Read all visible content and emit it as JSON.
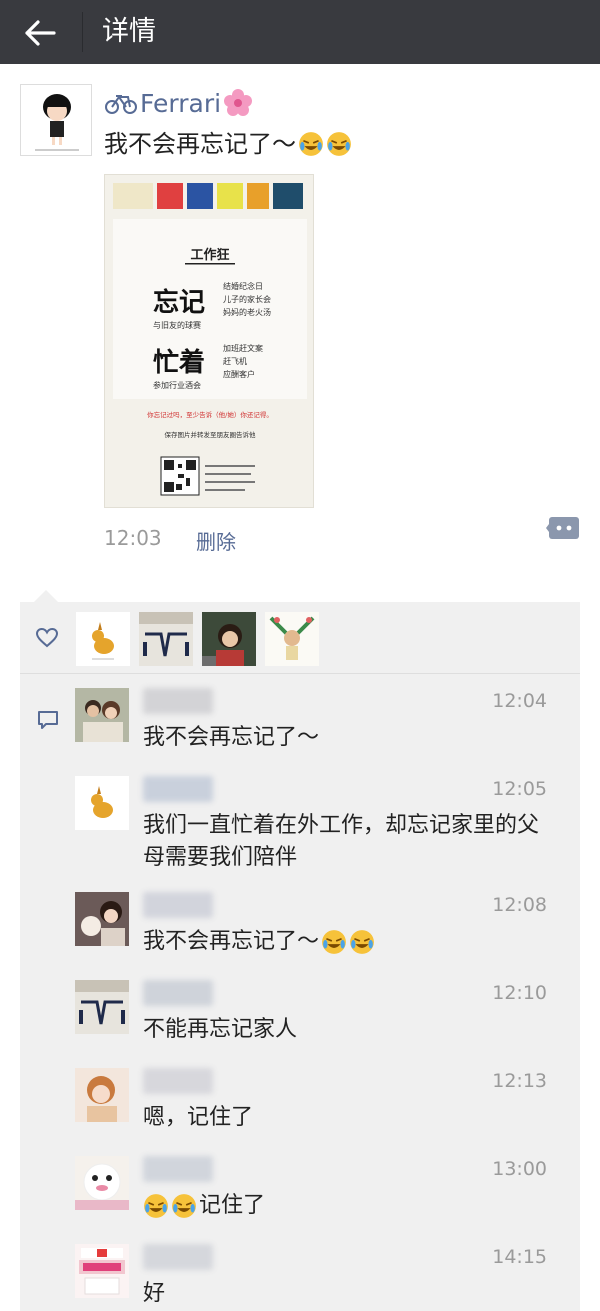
{
  "header": {
    "title": "详情"
  },
  "post": {
    "author": "Ferrari",
    "text": "我不会再忘记了～",
    "time": "12:03",
    "delete_label": "删除",
    "poster": {
      "heading": "工作狂",
      "big1": "忘记",
      "small1": "与旧友的球赛",
      "list1": [
        "结婚纪念日",
        "儿子的家长会",
        "妈妈的老火汤"
      ],
      "big2": "忙着",
      "small2": "参加行业酒会",
      "list2": [
        "加班赶文案",
        "赶飞机",
        "应酬客户"
      ],
      "red_line": "你忘记过吗，至少告诉（他/她）你还记得。",
      "cta": "保存图片并转发至朋友圈告诉他"
    }
  },
  "comments": [
    {
      "time": "12:04",
      "text": "我不会再忘记了～"
    },
    {
      "time": "12:05",
      "text": "我们一直忙着在外工作，却忘记家里的父母需要我们陪伴"
    },
    {
      "time": "12:08",
      "text": "我不会再忘记了～"
    },
    {
      "time": "12:10",
      "text": "不能再忘记家人"
    },
    {
      "time": "12:13",
      "text": "嗯，记住了"
    },
    {
      "time": "13:00",
      "text": "记住了"
    },
    {
      "time": "14:15",
      "text": "好"
    }
  ],
  "colors": {
    "topbar": "#393a3f",
    "link": "#576b95",
    "panel": "#f0f0f0"
  }
}
